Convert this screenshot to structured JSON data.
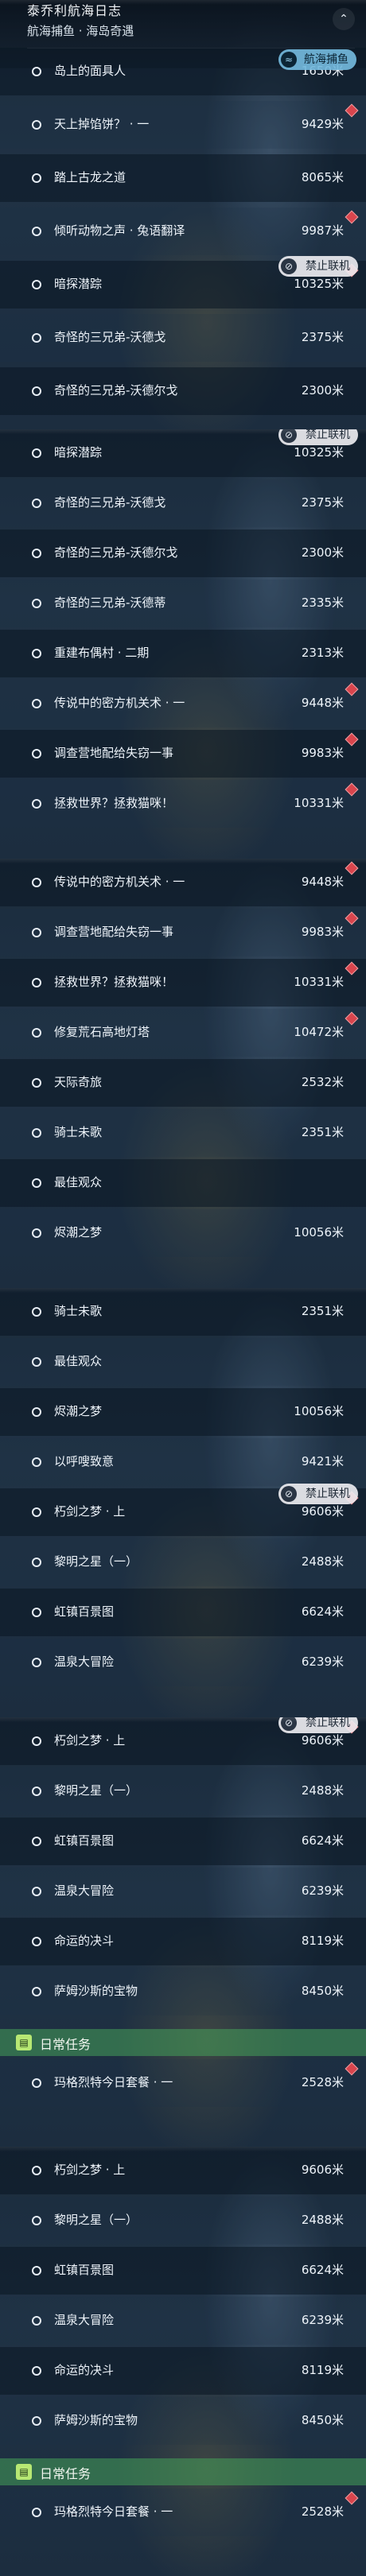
{
  "header": {
    "title": "泰乔利航海日志",
    "subtitle": "航海捕鱼 · 海岛奇遇",
    "toggle_icon": "chevron-up-icon"
  },
  "tags": {
    "sea_fishing": "航海捕鱼",
    "no_coop": "禁止联机"
  },
  "section_daily": "日常任务",
  "panels": [
    {
      "rows": [
        {
          "label": "岛上的面具人",
          "dist": "1650米"
        },
        {
          "label": "天上掉馅饼？ · 一",
          "dist": "9429米",
          "dot": true
        },
        {
          "label": "踏上古龙之道",
          "dist": "8065米"
        },
        {
          "label": "倾听动物之声 · 兔语翻译",
          "dist": "9987米",
          "dot": true
        },
        {
          "label": "暗探潜踪",
          "dist": "10325米",
          "tag": "no_coop",
          "dot": true
        },
        {
          "label": "奇怪的三兄弟-沃德戈",
          "dist": "2375米"
        },
        {
          "label": "奇怪的三兄弟-沃德尔戈",
          "dist": "2300米"
        }
      ]
    },
    {
      "rows": [
        {
          "label": "暗探潜踪",
          "dist": "10325米",
          "tag": "no_coop"
        },
        {
          "label": "奇怪的三兄弟-沃德戈",
          "dist": "2375米"
        },
        {
          "label": "奇怪的三兄弟-沃德尔戈",
          "dist": "2300米"
        },
        {
          "label": "奇怪的三兄弟-沃德蒂",
          "dist": "2335米"
        },
        {
          "label": "重建布偶村 · 二期",
          "dist": "2313米"
        },
        {
          "label": "传说中的密方机关术 · 一",
          "dist": "9448米",
          "dot": true
        },
        {
          "label": "调查营地配给失窃一事",
          "dist": "9983米",
          "dot": true
        },
        {
          "label": "拯救世界？拯救猫咪！",
          "dist": "10331米",
          "dot": true
        }
      ]
    },
    {
      "rows": [
        {
          "label": "传说中的密方机关术 · 一",
          "dist": "9448米",
          "dot": true
        },
        {
          "label": "调查营地配给失窃一事",
          "dist": "9983米",
          "dot": true
        },
        {
          "label": "拯救世界？拯救猫咪！",
          "dist": "10331米",
          "dot": true
        },
        {
          "label": "修复荒石高地灯塔",
          "dist": "10472米",
          "dot": true
        },
        {
          "label": "天际奇旅",
          "dist": "2532米"
        },
        {
          "label": "骑士未歌",
          "dist": "2351米"
        },
        {
          "label": "最佳观众",
          "dist": ""
        },
        {
          "label": "烬潮之梦",
          "dist": "10056米"
        }
      ]
    },
    {
      "rows": [
        {
          "label": "骑士未歌",
          "dist": "2351米"
        },
        {
          "label": "最佳观众",
          "dist": ""
        },
        {
          "label": "烬潮之梦",
          "dist": "10056米"
        },
        {
          "label": "以呼嗖致意",
          "dist": "9421米"
        },
        {
          "label": "朽剑之梦 · 上",
          "dist": "9606米",
          "tag": "no_coop",
          "dot": true
        },
        {
          "label": "黎明之星（一）",
          "dist": "2488米"
        },
        {
          "label": "虹镇百景图",
          "dist": "6624米"
        },
        {
          "label": "温泉大冒险",
          "dist": "6239米"
        }
      ]
    },
    {
      "rows": [
        {
          "label": "朽剑之梦 · 上",
          "dist": "9606米",
          "tag": "no_coop",
          "dot": true
        },
        {
          "label": "黎明之星（一）",
          "dist": "2488米"
        },
        {
          "label": "虹镇百景图",
          "dist": "6624米"
        },
        {
          "label": "温泉大冒险",
          "dist": "6239米"
        },
        {
          "label": "命运的决斗",
          "dist": "8119米"
        },
        {
          "label": "萨姆沙斯的宝物",
          "dist": "8450米"
        },
        {
          "section": true
        },
        {
          "label": "玛格烈特今日套餐 · 一",
          "dist": "2528米",
          "dot": true
        }
      ]
    },
    {
      "rows": [
        {
          "label": "朽剑之梦 · 上",
          "dist": "9606米"
        },
        {
          "label": "黎明之星（一）",
          "dist": "2488米"
        },
        {
          "label": "虹镇百景图",
          "dist": "6624米"
        },
        {
          "label": "温泉大冒险",
          "dist": "6239米"
        },
        {
          "label": "命运的决斗",
          "dist": "8119米"
        },
        {
          "label": "萨姆沙斯的宝物",
          "dist": "8450米"
        },
        {
          "section": true
        },
        {
          "label": "玛格烈特今日套餐 · 一",
          "dist": "2528米",
          "dot": true
        }
      ]
    }
  ]
}
